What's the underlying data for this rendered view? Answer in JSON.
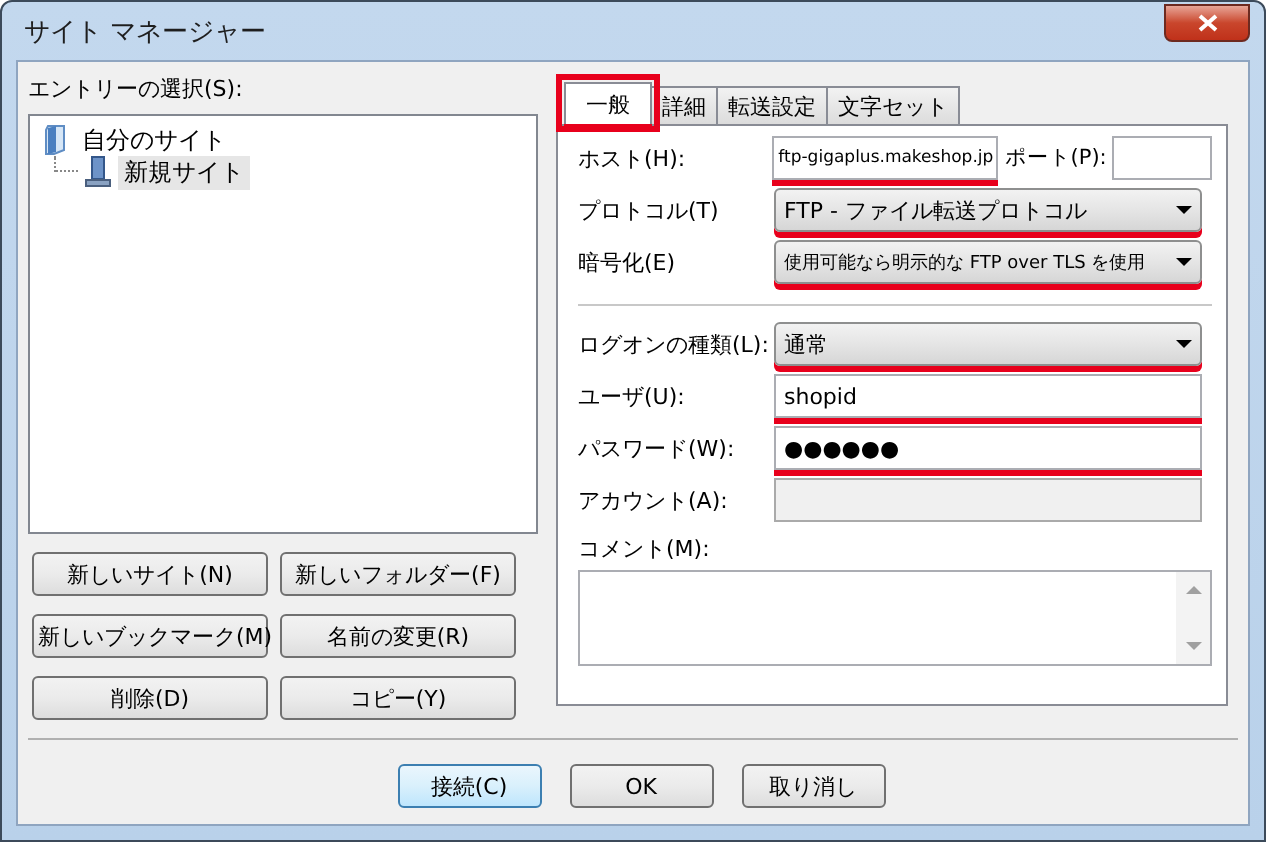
{
  "window": {
    "title": "サイト マネージャー"
  },
  "entries": {
    "label": "エントリーの選択(S):",
    "tree": [
      {
        "label": "自分のサイト",
        "kind": "folder",
        "selected": false,
        "children": [
          {
            "label": "新規サイト",
            "kind": "site",
            "selected": true
          }
        ]
      }
    ]
  },
  "entry_buttons": [
    "新しいサイト(N)",
    "新しいフォルダー(F)",
    "新しいブックマーク(M)",
    "名前の変更(R)",
    "削除(D)",
    "コピー(Y)"
  ],
  "tabs": [
    {
      "label": "一般",
      "selected": true,
      "marked": true
    },
    {
      "label": "詳細",
      "selected": false,
      "marked": false
    },
    {
      "label": "転送設定",
      "selected": false,
      "marked": false
    },
    {
      "label": "文字セット",
      "selected": false,
      "marked": false
    }
  ],
  "host": {
    "label": "ホスト(H):",
    "value": "ftp-gigaplus.makeshop.jp",
    "marked": true
  },
  "port": {
    "label": "ポート(P):"
  },
  "connection_fields": [
    {
      "kind": "select",
      "label": "プロトコル(T)",
      "value": "FTP - ファイル転送プロトコル",
      "marked": true
    },
    {
      "kind": "select",
      "label": "暗号化(E)",
      "value": "使用可能なら明示的な FTP over TLS を使用",
      "marked": true
    }
  ],
  "login_fields": [
    {
      "kind": "select",
      "label": "ログオンの種類(L):",
      "value": "通常",
      "marked": true
    },
    {
      "kind": "text",
      "label": "ユーザ(U):",
      "value": "shopid",
      "marked": true,
      "disabled": false
    },
    {
      "kind": "text",
      "label": "パスワード(W):",
      "value": "●●●●●●",
      "marked": true,
      "disabled": false
    },
    {
      "kind": "text",
      "label": "アカウント(A):",
      "marked": false,
      "disabled": true
    }
  ],
  "comment": {
    "label": "コメント(M):"
  },
  "dialog_buttons": [
    {
      "label": "接続(C)",
      "default": true
    },
    {
      "label": "OK",
      "default": false
    },
    {
      "label": "取り消し",
      "default": false
    }
  ]
}
